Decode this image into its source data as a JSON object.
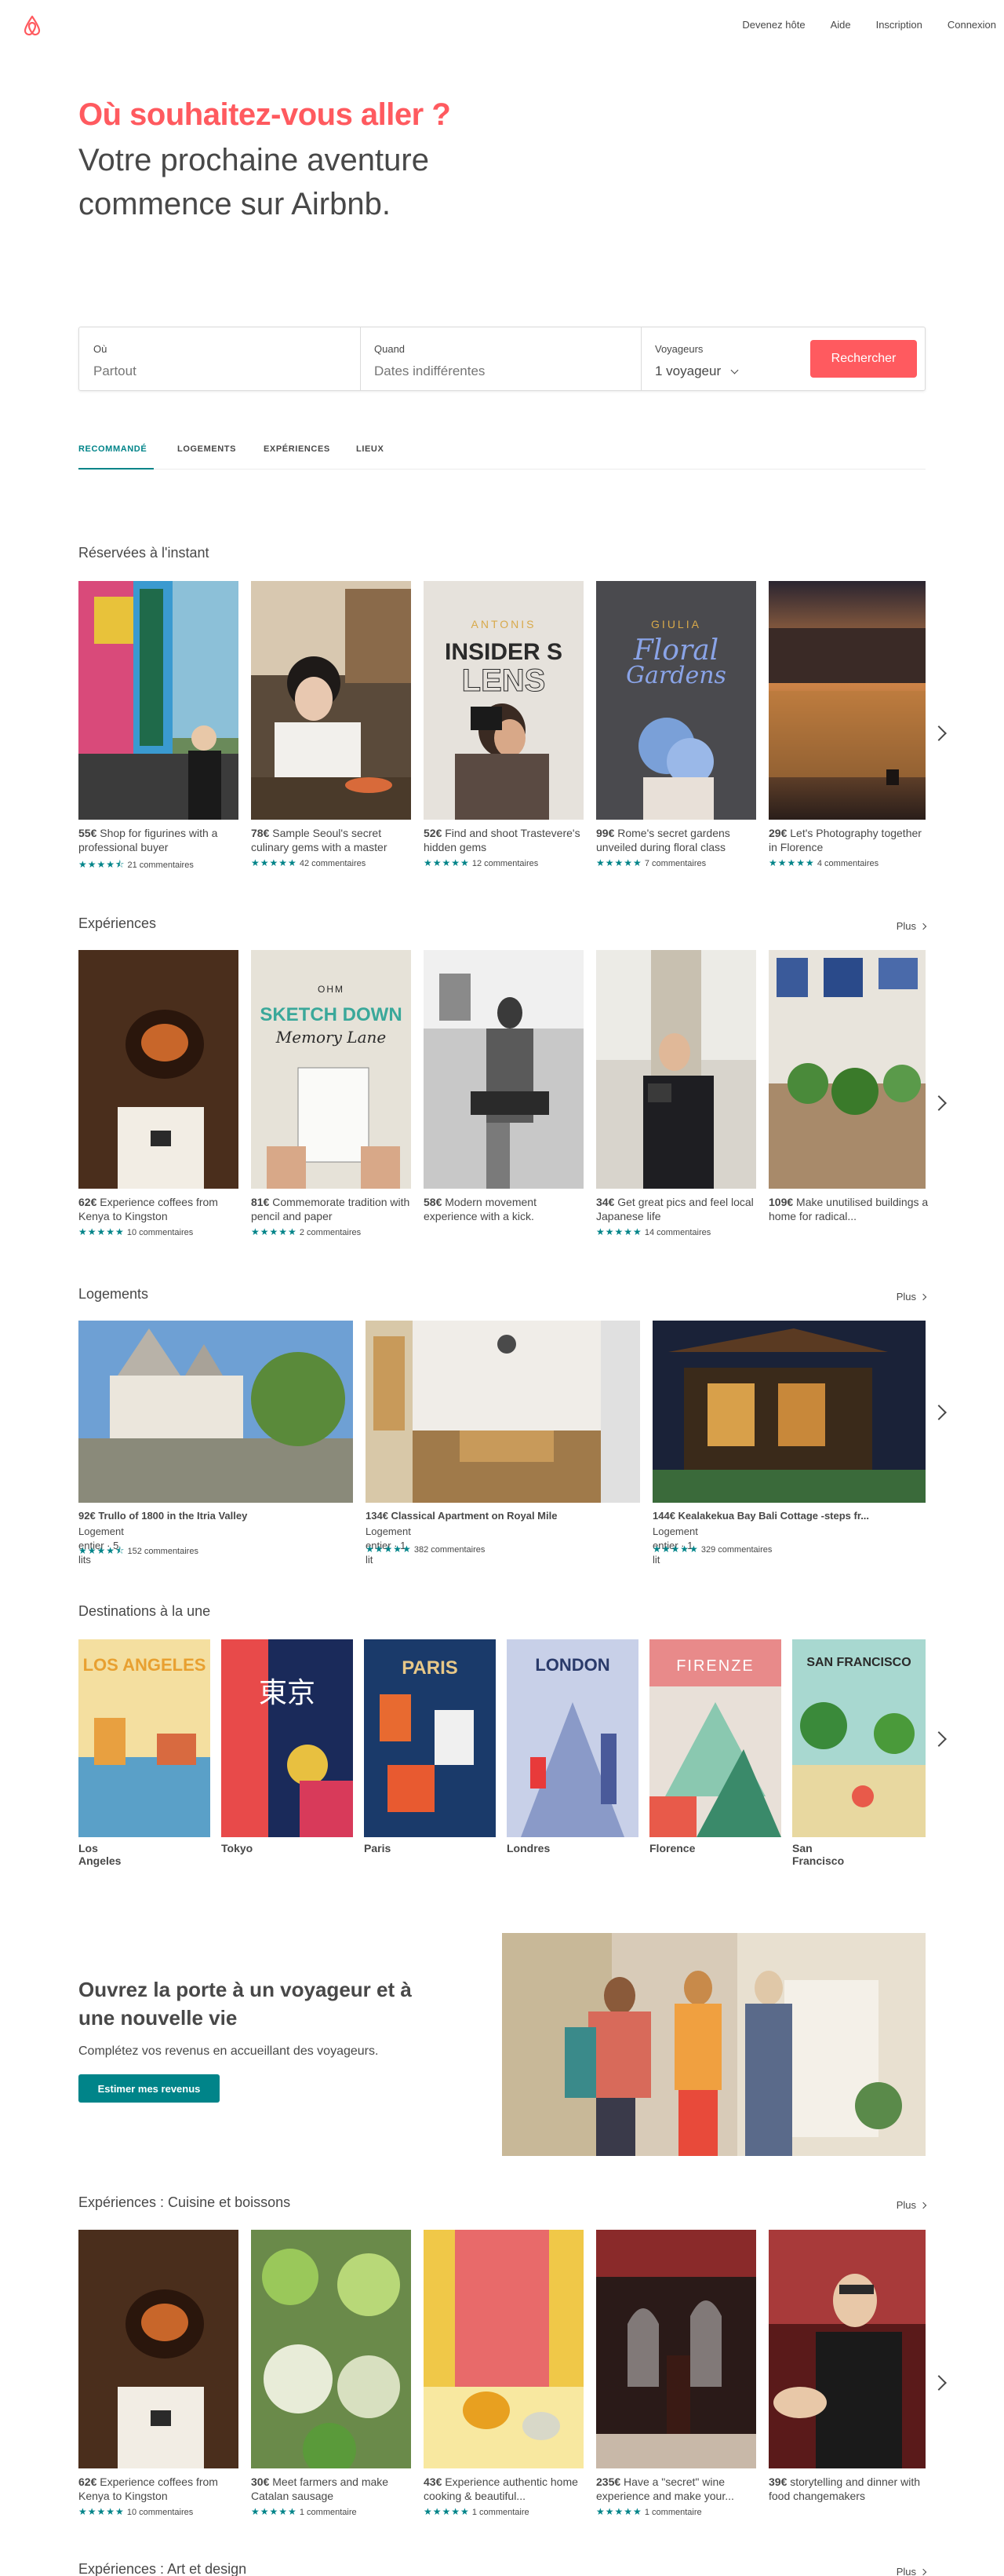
{
  "header": {
    "logo": "airbnb-logo",
    "nav": [
      "Devenez hôte",
      "Aide",
      "Inscription",
      "Connexion"
    ]
  },
  "hero": {
    "title": "Où souhaitez-vous aller ?",
    "subtitle": "Votre prochaine aventure commence sur Airbnb."
  },
  "search": {
    "where_label": "Où",
    "where_placeholder": "Partout",
    "when_label": "Quand",
    "when_placeholder": "Dates indifférentes",
    "guests_label": "Voyageurs",
    "guests_value": "1 voyageur",
    "button": "Rechercher"
  },
  "tabs": [
    "RECOMMANDÉ",
    "LOGEMENTS",
    "EXPÉRIENCES",
    "LIEUX"
  ],
  "colors": {
    "brand": "#FF5A5F",
    "accent": "#008489",
    "text": "#484848"
  },
  "booked_now": {
    "title": "Réservées à l'instant",
    "items": [
      {
        "price": "55€",
        "text": "Shop for figurines with a professional buyer",
        "reviews": "21 commentaires",
        "rating": 4.5
      },
      {
        "price": "78€",
        "text": "Sample Seoul's secret culinary gems with a master",
        "reviews": "42 commentaires",
        "rating": 5
      },
      {
        "price": "52€",
        "text": "Find and shoot Trastevere's hidden gems",
        "reviews": "12 commentaires",
        "rating": 5
      },
      {
        "price": "99€",
        "text": "Rome's secret gardens unveiled during floral class",
        "reviews": "7 commentaires",
        "rating": 5
      },
      {
        "price": "29€",
        "text": "Let's Photography together in Florence",
        "reviews": "4 commentaires",
        "rating": 5
      }
    ]
  },
  "experiences": {
    "title": "Expériences",
    "more": "Plus",
    "items": [
      {
        "price": "62€",
        "text": "Experience coffees from Kenya to Kingston",
        "reviews": "10 commentaires",
        "rating": 5
      },
      {
        "price": "81€",
        "text": "Commemorate tradition with pencil and paper",
        "reviews": "2 commentaires",
        "rating": 5
      },
      {
        "price": "58€",
        "text": "Modern movement experience with a kick.",
        "reviews": "",
        "rating": 0
      },
      {
        "price": "34€",
        "text": "Get great pics and feel local Japanese life",
        "reviews": "14 commentaires",
        "rating": 5
      },
      {
        "price": "109€",
        "text": "Make unutilised buildings a home for radical...",
        "reviews": "",
        "rating": 0
      }
    ]
  },
  "homes": {
    "title": "Logements",
    "more": "Plus",
    "items": [
      {
        "price": "92€",
        "name": "Trullo of 1800 in the Itria Valley",
        "type": "Logement entier · 5 lits",
        "reviews": "152 commentaires",
        "rating": 4.5
      },
      {
        "price": "134€",
        "name": "Classical Apartment on Royal Mile",
        "type": "Logement entier · 1 lit",
        "reviews": "382 commentaires",
        "rating": 5
      },
      {
        "price": "144€",
        "name": "Kealakekua Bay Bali Cottage -steps fr...",
        "type": "Logement entier · 1 lit",
        "reviews": "329 commentaires",
        "rating": 5
      }
    ]
  },
  "destinations": {
    "title": "Destinations à la une",
    "items": [
      {
        "name": "Los Angeles",
        "poster": "LOS ANGELES"
      },
      {
        "name": "Tokyo",
        "poster": "東京"
      },
      {
        "name": "Paris",
        "poster": "PARIS"
      },
      {
        "name": "Londres",
        "poster": "LONDON"
      },
      {
        "name": "Florence",
        "poster": "FIRENZE"
      },
      {
        "name": "San Francisco",
        "poster": "SAN FRANCISCO"
      }
    ]
  },
  "promo": {
    "title": "Ouvrez la porte à un voyageur et à une nouvelle vie",
    "subtitle": "Complétez vos revenus en accueillant des voyageurs.",
    "button": "Estimer mes revenus"
  },
  "food": {
    "title": "Expériences : Cuisine et boissons",
    "more": "Plus",
    "items": [
      {
        "price": "62€",
        "text": "Experience coffees from Kenya to Kingston",
        "reviews": "10 commentaires",
        "rating": 5
      },
      {
        "price": "30€",
        "text": "Meet farmers and make Catalan sausage",
        "reviews": "1 commentaire",
        "rating": 5
      },
      {
        "price": "43€",
        "text": "Experience authentic home cooking & beautiful...",
        "reviews": "1 commentaire",
        "rating": 5
      },
      {
        "price": "235€",
        "text": "Have a \"secret\" wine experience and make your...",
        "reviews": "1 commentaire",
        "rating": 5
      },
      {
        "price": "39€",
        "text": "storytelling and dinner with food changemakers",
        "reviews": "",
        "rating": 0
      }
    ]
  },
  "art": {
    "title": "Expériences : Art et design",
    "more": "Plus"
  }
}
